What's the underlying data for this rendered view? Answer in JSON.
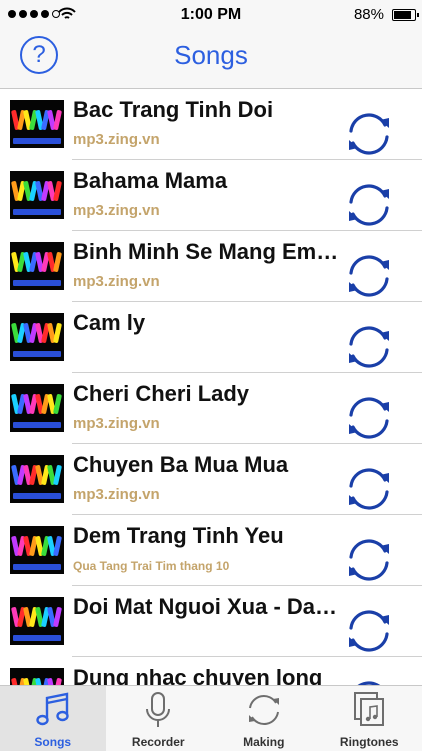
{
  "status_bar": {
    "time": "1:00 PM",
    "battery": "88%",
    "battery_level": 0.88,
    "signal_bars": 4,
    "signal_total": 5
  },
  "nav": {
    "title": "Songs",
    "help_label": "?"
  },
  "songs": [
    {
      "title": "Bac Trang Tinh Doi",
      "subtitle": "mp3.zing.vn"
    },
    {
      "title": "Bahama Mama",
      "subtitle": "mp3.zing.vn"
    },
    {
      "title": "Binh Minh Se Mang Em…",
      "subtitle": "mp3.zing.vn"
    },
    {
      "title": "Cam ly",
      "subtitle": ""
    },
    {
      "title": "Cheri Cheri Lady",
      "subtitle": "mp3.zing.vn"
    },
    {
      "title": "Chuyen Ba Mua Mua",
      "subtitle": "mp3.zing.vn"
    },
    {
      "title": "Dem Trang Tinh Yeu",
      "subtitle": "Qua Tang Trai Tim thang 10"
    },
    {
      "title": "Doi Mat Nguoi Xua - Da…",
      "subtitle": ""
    },
    {
      "title": "Dung nhac chuyen long",
      "subtitle": ""
    }
  ],
  "tabs": [
    {
      "label": "Songs",
      "icon": "music-note-icon",
      "active": true
    },
    {
      "label": "Recorder",
      "icon": "microphone-icon",
      "active": false
    },
    {
      "label": "Making",
      "icon": "refresh-icon",
      "active": false
    },
    {
      "label": "Ringtones",
      "icon": "ringtone-files-icon",
      "active": false
    }
  ],
  "colors": {
    "accent": "#2c5fe0",
    "subtitle": "#c4a46b",
    "refresh_icon": "#1a3fa8",
    "bar_bg": "#f7f7f7"
  }
}
